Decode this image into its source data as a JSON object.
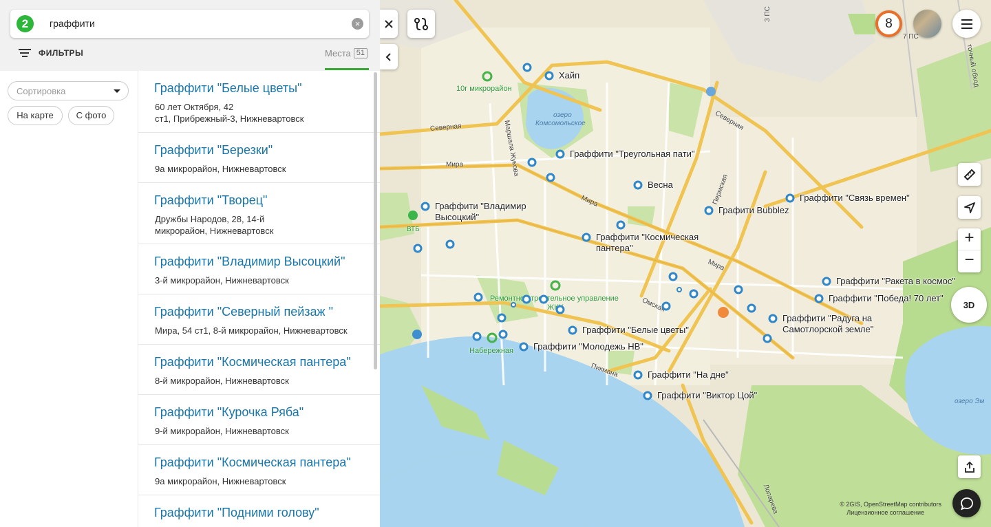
{
  "search": {
    "logo": "2",
    "query": "граффити",
    "clear_icon": "clear-icon"
  },
  "filters": {
    "label": "ФИЛЬТРЫ"
  },
  "tabs": {
    "places_label": "Места",
    "places_count": "51"
  },
  "side": {
    "sort_placeholder": "Сортировка",
    "chip_map": "На карте",
    "chip_photo": "С фото"
  },
  "results": [
    {
      "title": "Граффити \"Белые цветы\"",
      "addr1": "60 лет Октября, 42",
      "addr2": "ст1, Прибрежный-3, Нижневартовск"
    },
    {
      "title": "Граффити \"Березки\"",
      "addr1": "9а микрорайон, Нижневартовск",
      "addr2": ""
    },
    {
      "title": "Граффити \"Творец\"",
      "addr1": "Дружбы Народов, 28, 14-й",
      "addr2": "микрорайон, Нижневартовск"
    },
    {
      "title": "Граффити \"Владимир Высоцкий\"",
      "addr1": "3-й микрорайон, Нижневартовск",
      "addr2": ""
    },
    {
      "title": "Граффити \"Северный пейзаж \"",
      "addr1": "Мира, 54 ст1, 8-й микрорайон, Нижневартовск",
      "addr2": ""
    },
    {
      "title": "Граффити \"Космическая пантера\"",
      "addr1": "8-й микрорайон, Нижневартовск",
      "addr2": ""
    },
    {
      "title": "Граффити \"Курочка Ряба\"",
      "addr1": "9-й микрорайон, Нижневартовск",
      "addr2": ""
    },
    {
      "title": "Граффити \"Космическая пантера\"",
      "addr1": "9а микрорайон, Нижневартовск",
      "addr2": ""
    },
    {
      "title": "Граффити \"Подними голову\"",
      "addr1": "",
      "addr2": ""
    }
  ],
  "map": {
    "places": {
      "hype": "Хайп",
      "triangle": "Граффити \"Треугольная пати\"",
      "spring": "Весна",
      "bubblez": "Графити Bubblez",
      "time_link": "Граффити \"Связь времен\"",
      "vysotsky_1": "Граффити \"Владимир",
      "vysotsky_2": "Высоцкий\"",
      "panther_1": "Граффити \"Космическая",
      "panther_2": "пантера\"",
      "rocket": "Граффити \"Ракета в космос\"",
      "victory": "Граффити \"Победа! 70 лет\"",
      "rainbow_1": "Граффити \"Радуга на",
      "rainbow_2": "Самотлорской земле\"",
      "white_flowers": "Граффити \"Белые цветы\"",
      "youth": "Граффити \"Молодежь НВ\"",
      "bottom": "Граффити \"На дне\"",
      "tsoi": "Граффити \"Виктор Цой\""
    },
    "labels": {
      "district_10g": "10г микрорайон",
      "lake_1": "озеро",
      "lake_2": "Комсомольское",
      "lake_east": "озеро Эм",
      "vtb": "ВТБ",
      "embankment": "Набережная",
      "repair": "Ремонтно-строительное управление",
      "repair2": "ЖКХ",
      "severnaya_w": "Северная",
      "severnaya_e": "Северная",
      "mira_w": "Мира",
      "mira_c": "Мира",
      "mira_e": "Мира",
      "marshal": "Маршала Жукова",
      "permskaya": "Пермская",
      "omskaya": "Омская",
      "piknaya": "Пикмана",
      "loparev": "Лопарева",
      "ps3": "3 ПС",
      "ps7": "7 ПС",
      "bypass": "точный обход"
    },
    "controls": {
      "close_icon": "close-icon",
      "collapse_icon": "chevron-left-icon",
      "route_icon": "route-icon",
      "notifications_count": "8",
      "menu_icon": "hamburger-icon",
      "ruler_icon": "ruler-icon",
      "locate_icon": "locate-arrow-icon",
      "zoom_in": "+",
      "zoom_out": "−",
      "mode_3d": "3D",
      "share_icon": "share-icon",
      "chat_icon": "chat-icon"
    },
    "copyright_1": "© 2GIS, OpenStreetMap contributors",
    "copyright_2": "Лицензионное соглашение"
  },
  "colors": {
    "accent_green": "#39a936",
    "link_blue": "#1976a9",
    "marker_blue": "#2f86c9",
    "water": "#a9d4ef",
    "road": "#f2c24f",
    "land": "#f3eedb",
    "park": "#c6e3a4",
    "notification_ring": "#e8702a"
  }
}
